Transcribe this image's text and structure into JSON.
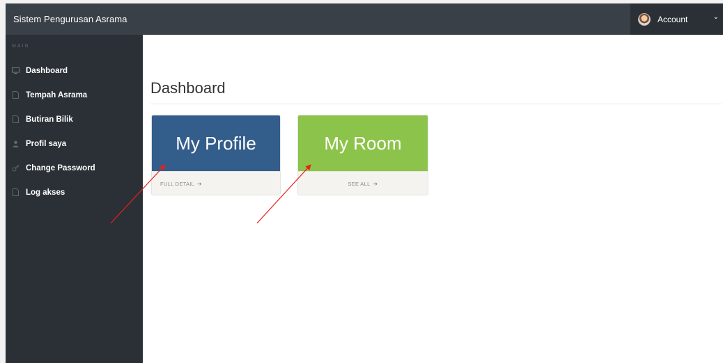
{
  "header": {
    "brand": "Sistem Pengurusan Asrama",
    "account_label": "Account"
  },
  "sidebar": {
    "section": "MAIN",
    "items": [
      {
        "label": "Dashboard",
        "icon": "monitor-icon"
      },
      {
        "label": "Tempah Asrama",
        "icon": "file-icon"
      },
      {
        "label": "Butiran Bilik",
        "icon": "file-icon"
      },
      {
        "label": "Profil saya",
        "icon": "user-icon"
      },
      {
        "label": "Change Password",
        "icon": "key-icon"
      },
      {
        "label": "Log akses",
        "icon": "file-icon"
      }
    ]
  },
  "main": {
    "title": "Dashboard",
    "cards": [
      {
        "title": "My Profile",
        "link": "FULL DETAIL",
        "color": "#335d8b"
      },
      {
        "title": "My Room",
        "link": "SEE ALL",
        "color": "#8cc34a"
      }
    ]
  },
  "colors": {
    "topbar": "#3a4047",
    "sidebar": "#2b3036",
    "annotation": "#e8201a"
  }
}
